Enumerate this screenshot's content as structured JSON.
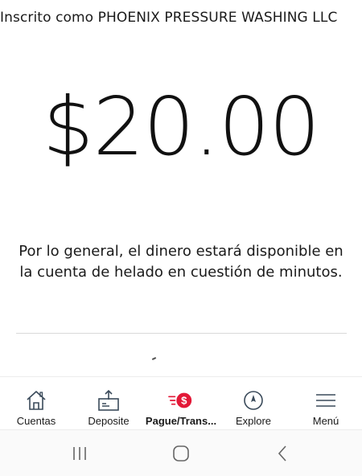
{
  "header": {
    "registered_as": "Inscrito como PHOENIX PRESSURE WASHING LLC"
  },
  "confirmation": {
    "amount": "$20.00",
    "message": "Por lo general, el dinero estará disponible en la cuenta de helado en cuestión de minutos."
  },
  "tabbar": {
    "items": [
      {
        "label": "Cuentas",
        "icon": "home-icon"
      },
      {
        "label": "Deposite",
        "icon": "deposit-icon"
      },
      {
        "label": "Pague/Trans...",
        "icon": "pay-transfer-icon",
        "active": true
      },
      {
        "label": "Explore",
        "icon": "compass-icon"
      },
      {
        "label": "Menú",
        "icon": "hamburger-menu-icon"
      }
    ]
  },
  "system_nav": {
    "buttons": [
      "recent-apps-icon",
      "home-button-icon",
      "back-icon"
    ]
  },
  "colors": {
    "accent": "#e31837",
    "text": "#1a1a1a",
    "icon": "#3a4a5a"
  }
}
